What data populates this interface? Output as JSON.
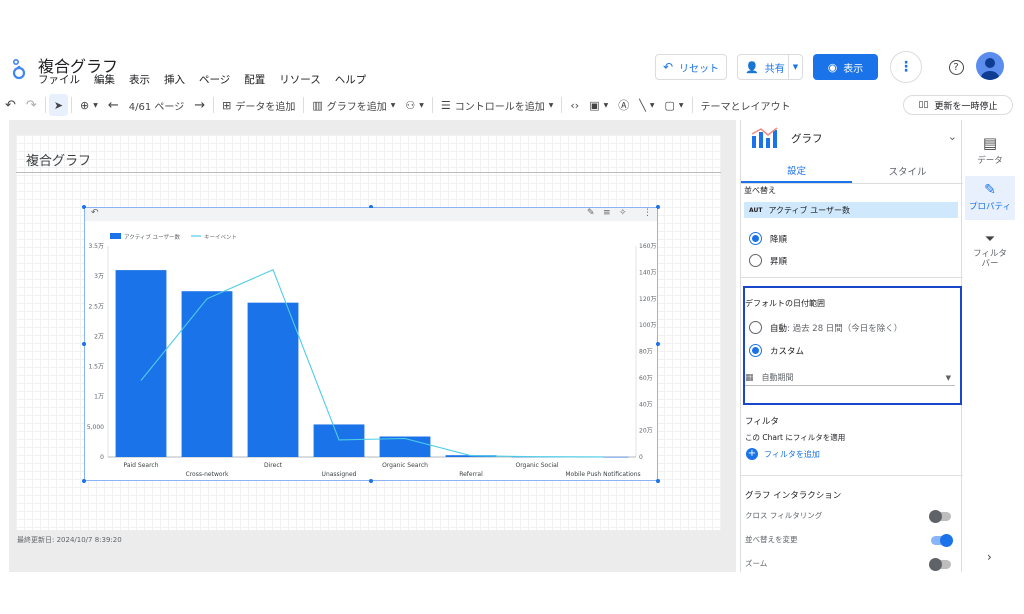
{
  "header": {
    "title": "複合グラフ",
    "menu": [
      "ファイル",
      "編集",
      "表示",
      "挿入",
      "ページ",
      "配置",
      "リソース",
      "ヘルプ"
    ],
    "reset_label": "リセット",
    "share_label": "共有",
    "view_label": "表示",
    "colors": {
      "accent": "#1a73e8"
    }
  },
  "toolbar": {
    "page_indicator": "4/61 ページ",
    "add_data": "データを追加",
    "add_chart": "グラフを追加",
    "add_control": "コントロールを追加",
    "theme_layout": "テーマとレイアウト",
    "pause_update": "更新を一時停止"
  },
  "canvas": {
    "page_title": "複合グラフ",
    "last_updated": "最終更新日: 2024/10/7 8:39:20"
  },
  "chart_data": {
    "type": "bar",
    "title": "",
    "categories": [
      "Paid Search",
      "Cross-network",
      "Direct",
      "Unassigned",
      "Organic Search",
      "Referral",
      "Organic Social",
      "Mobile Push Notifications"
    ],
    "series": [
      {
        "name": "アクティブ ユーザー数",
        "type": "bar",
        "axis": "left",
        "color": "#1a73e8",
        "values": [
          31000,
          27500,
          25600,
          5400,
          3400,
          300,
          60,
          30
        ]
      },
      {
        "name": "キーイベント",
        "type": "line",
        "axis": "right",
        "color": "#4ecde6",
        "values": [
          580000,
          1200000,
          1420000,
          130000,
          140000,
          10000,
          2000,
          1000
        ]
      }
    ],
    "y_left": {
      "ylim": [
        0,
        35000
      ],
      "ticks": [
        "0",
        "5,000",
        "1万",
        "1.5万",
        "2万",
        "2.5万",
        "3万",
        "3.5万"
      ]
    },
    "y_right": {
      "ylim": [
        0,
        1600000
      ],
      "ticks": [
        "0",
        "20万",
        "40万",
        "60万",
        "80万",
        "100万",
        "120万",
        "140万",
        "160万"
      ]
    },
    "legend": "top-left",
    "grid": false
  },
  "panel": {
    "chart_type_label": "グラフ",
    "tabs": [
      "設定",
      "スタイル"
    ],
    "sort_label": "並べ替え",
    "sort_metric_badge": "AUT",
    "sort_metric": "アクティブ ユーザー数",
    "sort_desc": "降順",
    "sort_asc": "昇順",
    "date_range_label": "デフォルトの日付範囲",
    "date_auto_prefix": "自動",
    "date_auto_detail": ": 過去 28 日間（今日を除く）",
    "date_custom": "カスタム",
    "date_select_value": "自動期間",
    "filter_title": "フィルタ",
    "filter_subtitle": "この Chart にフィルタを適用",
    "filter_add": "フィルタを追加",
    "interaction_title": "グラフ インタラクション",
    "cross_filter": "クロス フィルタリング",
    "change_sort": "並べ替えを変更",
    "zoom": "ズーム"
  },
  "rail": {
    "data": "データ",
    "properties": "プロパティ",
    "filter_bar": "フィルタバー"
  }
}
